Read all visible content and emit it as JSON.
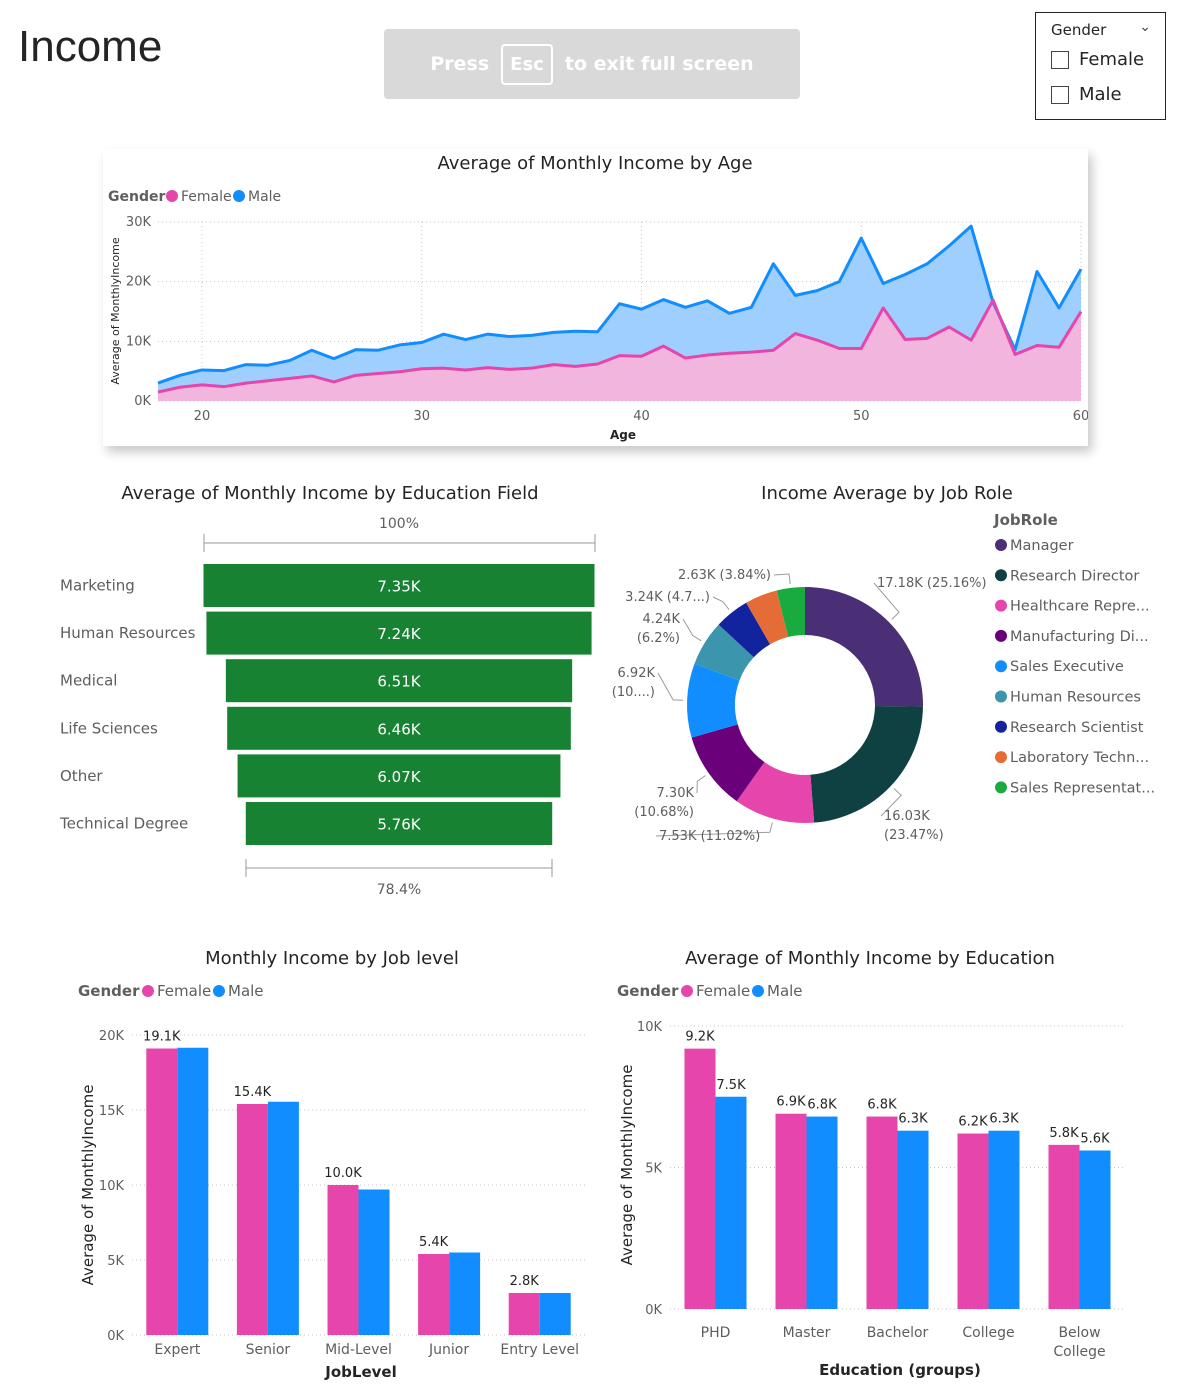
{
  "page": {
    "title": "Income"
  },
  "banner": {
    "prefix": "Press",
    "key": "Esc",
    "suffix": "to exit full screen"
  },
  "slicer": {
    "title": "Gender",
    "options": [
      "Female",
      "Male"
    ]
  },
  "colors": {
    "female": "#e645ab",
    "male": "#118dff",
    "female_area": "#f5b3dc",
    "male_area": "#9fcfff",
    "funnel": "#168232",
    "grid": "#c8c6c4"
  },
  "chart_data": [
    {
      "id": "age",
      "type": "area",
      "title": "Average of Monthly Income by Age",
      "xlabel": "Age",
      "ylabel": "Average of MonthlyIncome",
      "legend_title": "Gender",
      "xlim": [
        18,
        60
      ],
      "ylim": [
        0,
        30000
      ],
      "xticks": [
        20,
        30,
        40,
        50,
        60
      ],
      "yticks": [
        0,
        10000,
        20000,
        30000
      ],
      "ytick_labels": [
        "0K",
        "10K",
        "20K",
        "30K"
      ],
      "x": [
        18,
        19,
        20,
        21,
        22,
        23,
        24,
        25,
        26,
        27,
        28,
        29,
        30,
        31,
        32,
        33,
        34,
        35,
        36,
        37,
        38,
        39,
        40,
        41,
        42,
        43,
        44,
        45,
        46,
        47,
        48,
        49,
        50,
        51,
        52,
        53,
        54,
        55,
        56,
        57,
        58,
        59,
        60
      ],
      "series": [
        {
          "name": "Female",
          "color": "#e645ab",
          "values": [
            1500,
            2300,
            2700,
            2400,
            3000,
            3400,
            3800,
            4200,
            3200,
            4300,
            4600,
            4900,
            5400,
            5500,
            5200,
            5600,
            5300,
            5500,
            6100,
            5800,
            6200,
            7600,
            7500,
            9200,
            7200,
            7700,
            8000,
            8200,
            8500,
            11300,
            10200,
            8800,
            8800,
            15600,
            10300,
            10500,
            12400,
            10200,
            16900,
            7800,
            9300,
            9000,
            15000
          ]
        },
        {
          "name": "Male",
          "color": "#118dff",
          "values": [
            3000,
            4300,
            5200,
            5100,
            6100,
            6000,
            6800,
            8500,
            7100,
            8600,
            8500,
            9400,
            9800,
            11200,
            10300,
            11200,
            10800,
            11000,
            11500,
            11700,
            11600,
            16300,
            15400,
            17000,
            15700,
            16800,
            14700,
            15700,
            23000,
            17700,
            18500,
            20000,
            27300,
            19700,
            21200,
            23000,
            26000,
            29300,
            16500,
            8600,
            21700,
            15600,
            22100
          ]
        }
      ]
    },
    {
      "id": "education_field",
      "type": "bar",
      "title": "Average of Monthly Income by Education Field",
      "top_pct": "100%",
      "bottom_pct": "78.4%",
      "categories": [
        "Marketing",
        "Human Resources",
        "Medical",
        "Life Sciences",
        "Other",
        "Technical Degree"
      ],
      "values": [
        7350,
        7240,
        6510,
        6460,
        6070,
        5760
      ],
      "value_labels": [
        "7.35K",
        "7.24K",
        "6.51K",
        "6.46K",
        "6.07K",
        "5.76K"
      ]
    },
    {
      "id": "job_role",
      "type": "pie",
      "title": "Income Average by Job Role",
      "legend_title": "JobRole",
      "slices": [
        {
          "name": "Manager",
          "legend": "Manager",
          "value": 17180,
          "pct": 25.16,
          "color": "#4a2f76",
          "label": "17.18K (25.16%)"
        },
        {
          "name": "Research Director",
          "legend": "Research Director",
          "value": 16030,
          "pct": 23.47,
          "color": "#0f4042",
          "label": [
            "16.03K",
            "(23.47%)"
          ]
        },
        {
          "name": "Healthcare Representative",
          "legend": "Healthcare Repre...",
          "value": 7530,
          "pct": 11.02,
          "color": "#e645ab",
          "label": "7.53K (11.02%)"
        },
        {
          "name": "Manufacturing Director",
          "legend": "Manufacturing Di...",
          "value": 7300,
          "pct": 10.68,
          "color": "#6b007b",
          "label": [
            "7.30K",
            "(10.68%)"
          ]
        },
        {
          "name": "Sales Executive",
          "legend": "Sales Executive",
          "value": 6920,
          "pct": 10.13,
          "color": "#118dff",
          "label": [
            "6.92K",
            "(10....)"
          ]
        },
        {
          "name": "Human Resources",
          "legend": "Human Resources",
          "value": 4240,
          "pct": 6.2,
          "color": "#3b96ad",
          "label": [
            "4.24K",
            "(6.2%)"
          ]
        },
        {
          "name": "Research Scientist",
          "legend": "Research Scientist",
          "value": 3240,
          "pct": 4.74,
          "color": "#12239e",
          "label": "3.24K (4.7...)"
        },
        {
          "name": "Laboratory Technician",
          "legend": "Laboratory Techn...",
          "value": 3030,
          "pct": 4.43,
          "color": "#e66c37",
          "label": ""
        },
        {
          "name": "Sales Representative",
          "legend": "Sales Representat...",
          "value": 2630,
          "pct": 3.84,
          "color": "#1aab40",
          "label": "2.63K (3.84%)"
        }
      ]
    },
    {
      "id": "job_level",
      "type": "bar",
      "title": "Monthly Income by Job level",
      "xlabel": "JobLevel",
      "ylabel": "Average of MonthlyIncome",
      "legend_title": "Gender",
      "categories": [
        "Expert",
        "Senior",
        "Mid-Level",
        "Junior",
        "Entry Level"
      ],
      "ylim": [
        0,
        20000
      ],
      "yticks": [
        0,
        5000,
        10000,
        15000,
        20000
      ],
      "ytick_labels": [
        "0K",
        "5K",
        "10K",
        "15K",
        "20K"
      ],
      "series": [
        {
          "name": "Female",
          "color": "#e645ab",
          "values": [
            19100,
            15400,
            10000,
            5400,
            2800
          ]
        },
        {
          "name": "Male",
          "color": "#118dff",
          "values": [
            19150,
            15550,
            9700,
            5500,
            2800
          ]
        }
      ],
      "data_labels": [
        {
          "category_index": 0,
          "text": "19.1K"
        },
        {
          "category_index": 1,
          "text": "15.4K"
        },
        {
          "category_index": 2,
          "text": "10.0K"
        },
        {
          "category_index": 3,
          "text": "5.4K"
        },
        {
          "category_index": 4,
          "text": "2.8K"
        }
      ]
    },
    {
      "id": "education",
      "type": "bar",
      "title": "Average of Monthly Income by Education",
      "xlabel": "Education (groups)",
      "ylabel": "Average of MonthlyIncome",
      "legend_title": "Gender",
      "categories": [
        "PHD",
        "Master",
        "Bachelor",
        "College",
        "Below College"
      ],
      "category_lines": [
        [
          "PHD"
        ],
        [
          "Master"
        ],
        [
          "Bachelor"
        ],
        [
          "College"
        ],
        [
          "Below",
          "College"
        ]
      ],
      "ylim": [
        0,
        10000
      ],
      "yticks": [
        0,
        5000,
        10000
      ],
      "ytick_labels": [
        "0K",
        "5K",
        "10K"
      ],
      "series": [
        {
          "name": "Female",
          "color": "#e645ab",
          "values": [
            9200,
            6900,
            6800,
            6200,
            5800
          ],
          "labels": [
            "9.2K",
            "6.9K",
            "6.8K",
            "6.2K",
            "5.8K"
          ]
        },
        {
          "name": "Male",
          "color": "#118dff",
          "values": [
            7500,
            6800,
            6300,
            6300,
            5600
          ],
          "labels": [
            "7.5K",
            "6.8K",
            "6.3K",
            "6.3K",
            "5.6K"
          ]
        }
      ]
    }
  ]
}
